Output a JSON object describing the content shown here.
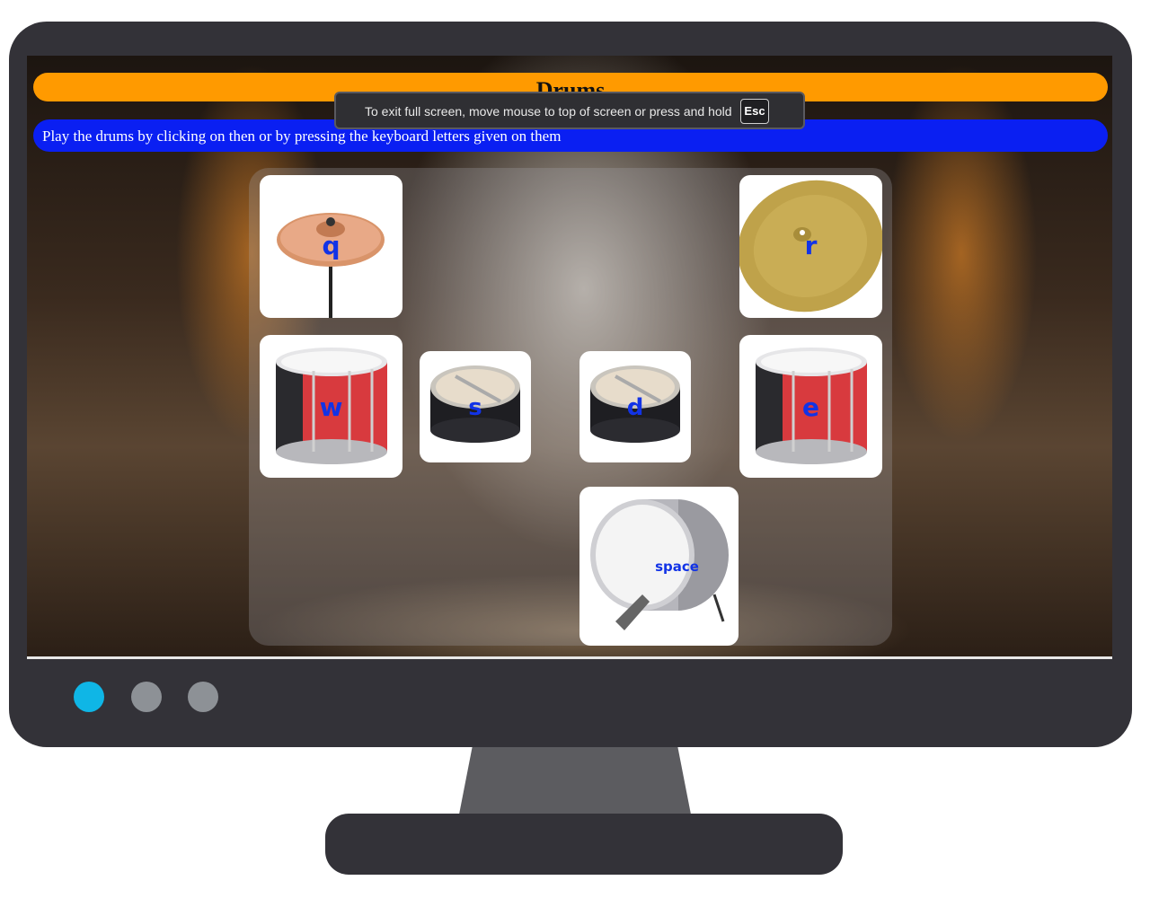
{
  "app": {
    "title": "Drums",
    "instructions": "Play the drums by clicking on then or by pressing the keyboard letters given on them"
  },
  "fullscreen_notice": {
    "text": "To exit full screen, move mouse to top of screen or press and hold",
    "key": "Esc"
  },
  "pads": [
    {
      "key": "q",
      "instrument": "splash-cymbal"
    },
    {
      "key": "r",
      "instrument": "crash-cymbal"
    },
    {
      "key": "w",
      "instrument": "tom-drum"
    },
    {
      "key": "s",
      "instrument": "snare-drum"
    },
    {
      "key": "d",
      "instrument": "snare-drum"
    },
    {
      "key": "e",
      "instrument": "tom-drum"
    },
    {
      "key": "space",
      "instrument": "bass-drum"
    }
  ],
  "colors": {
    "title_bar": "#ff9a00",
    "instructions_bar": "#0a1ff2",
    "key_label": "#1233e6",
    "monitor_frame": "#333238",
    "indicator_active": "#0fb6e6",
    "indicator_inactive": "#8d9196"
  }
}
